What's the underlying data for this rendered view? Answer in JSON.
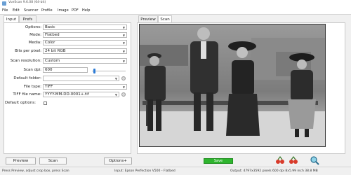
{
  "window": {
    "title": "VueScan 9.6.08 (64-bit)"
  },
  "menu": [
    "File",
    "Edit",
    "Scanner",
    "Profile",
    "Image",
    "PDF",
    "Help"
  ],
  "left_tabs": [
    "Input",
    "Prefs"
  ],
  "right_tabs": [
    "Preview",
    "Scan"
  ],
  "settings": {
    "options": {
      "label": "Options:",
      "value": "Basic"
    },
    "mode": {
      "label": "Mode:",
      "value": "Flatbed"
    },
    "media": {
      "label": "Media:",
      "value": "Color"
    },
    "bits": {
      "label": "Bits per pixel:",
      "value": "24 bit RGB"
    },
    "scan_resolution": {
      "label": "Scan resolution:",
      "value": "Custom"
    },
    "scan_dpi": {
      "label": "Scan dpi:",
      "value": "600"
    },
    "default_folder": {
      "label": "Default folder:",
      "value": ""
    },
    "file_type": {
      "label": "File type:",
      "value": "TIFF"
    },
    "tiff_file_name": {
      "label": "TIFF file name:",
      "value": "YYYY-MM-DD-0001+.tif"
    },
    "default_options": {
      "label": "Default options:"
    }
  },
  "buttons": {
    "preview": "Preview",
    "scan": "Scan",
    "options": "Options+",
    "save": "Save"
  },
  "status": {
    "left": "Press Preview, adjust crop box, press Scan",
    "middle": "Input: Epson Perfection V500 - Flatbed",
    "right": "Output: 4797x3592 pixels 600 dpi 8x5.99 inch 38.8 MB"
  },
  "colors": {
    "save_green": "#2fb52f",
    "accent_blue": "#2b7bd6"
  }
}
